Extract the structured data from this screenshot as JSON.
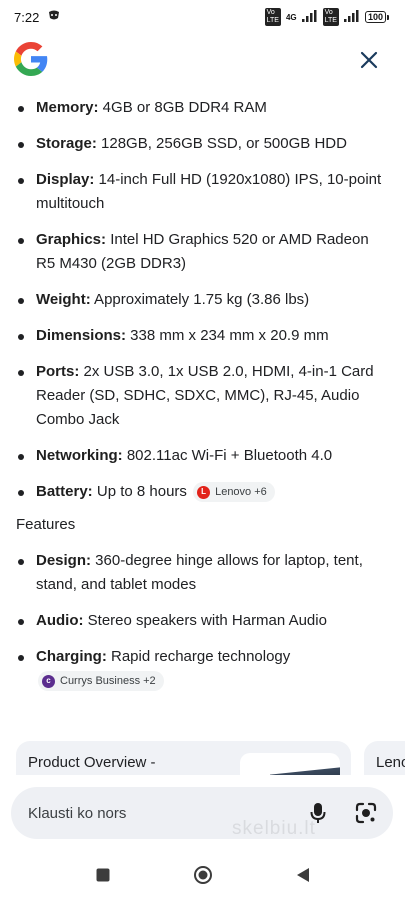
{
  "status_bar": {
    "time": "7:22",
    "battery": "100",
    "sim1_label": "4G",
    "sim2_label": "4G"
  },
  "header": {
    "logo": "google-logo",
    "close_icon": "close-icon"
  },
  "specs": [
    {
      "label": "Memory:",
      "value": " 4GB or 8GB DDR4 RAM"
    },
    {
      "label": "Storage:",
      "value": " 128GB, 256GB SSD, or 500GB HDD"
    },
    {
      "label": "Display:",
      "value": " 14-inch Full HD (1920x1080) IPS, 10-point multitouch"
    },
    {
      "label": "Graphics:",
      "value": " Intel HD Graphics 520 or AMD Radeon R5 M430 (2GB DDR3)"
    },
    {
      "label": "Weight:",
      "value": " Approximately 1.75 kg (3.86 lbs)"
    },
    {
      "label": "Dimensions:",
      "value": " 338 mm x 234 mm x 20.9 mm"
    },
    {
      "label": "Ports:",
      "value": " 2x USB 3.0, 1x USB 2.0, HDMI, 4-in-1 Card Reader (SD, SDHC, SDXC, MMC), RJ-45, Audio Combo Jack"
    },
    {
      "label": "Networking:",
      "value": " 802.11ac Wi-Fi + Bluetooth 4.0"
    },
    {
      "label": "Battery:",
      "value": " Up to 8 hours ",
      "chip": "Lenovo +6"
    }
  ],
  "features_heading": "Features",
  "features": [
    {
      "label": "Design:",
      "value": " 360-degree hinge allows for laptop, tent, stand, and tablet modes"
    },
    {
      "label": "Audio:",
      "value": " Stereo speakers with Harman Audio"
    },
    {
      "label": "Charging:",
      "value": " Rapid recharge technology ",
      "chip": "Currys Business +2"
    }
  ],
  "cards": [
    {
      "title": "Product Overview -"
    },
    {
      "title": "Leno"
    }
  ],
  "search": {
    "placeholder": "Klausti ko nors"
  },
  "watermark": "skelbiu.lt",
  "colors": {
    "chip_bg": "#f1f3f4",
    "lenovo_red": "#e2231a",
    "currys_purple": "#5b2d8e",
    "search_bg": "#eef0f4",
    "card_bg": "#f0f2f6"
  }
}
